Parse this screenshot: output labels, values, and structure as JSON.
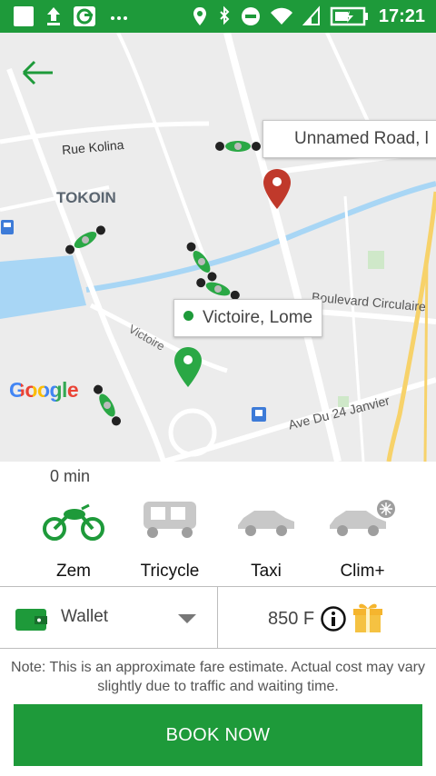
{
  "status_bar": {
    "time": "17:21"
  },
  "map": {
    "labels": {
      "rue_kolina": "Rue Kolina",
      "tokoin": "TOKOIN",
      "boulevard": "Boulevard Circulaire",
      "victoire_street": "Victoire",
      "ave_24_janvier": "Ave Du 24 Janvier"
    },
    "destination_bubble": "Unnamed Road, l",
    "pickup_bubble": "Victoire, Lome",
    "logo": "Google"
  },
  "eta": "0 min",
  "vehicles": [
    {
      "label": "Zem",
      "selected": true
    },
    {
      "label": "Tricycle",
      "selected": false
    },
    {
      "label": "Taxi",
      "selected": false
    },
    {
      "label": "Clim+",
      "selected": false
    }
  ],
  "payment": {
    "method": "Wallet"
  },
  "fare": {
    "amount": "850 F"
  },
  "note": "Note: This is an approximate fare estimate. Actual cost may vary slightly due to traffic and waiting time.",
  "book_button": "BOOK NOW",
  "colors": {
    "brand": "#1e9a3a",
    "road": "#ffffff",
    "water": "#a8d6f5",
    "highway": "#f7d26a",
    "pin_red": "#c0392b"
  }
}
